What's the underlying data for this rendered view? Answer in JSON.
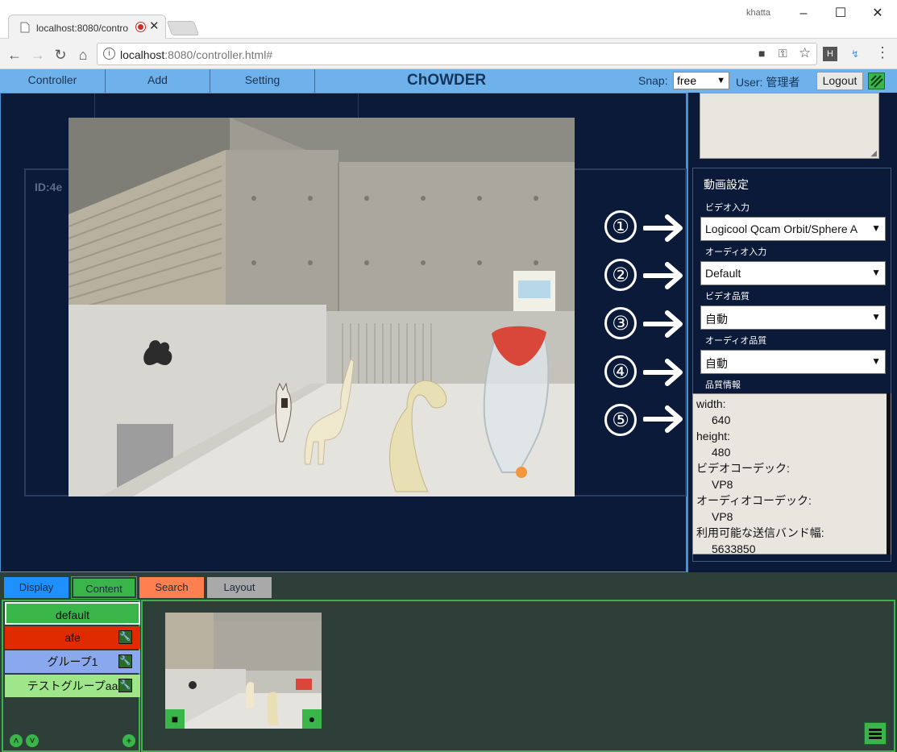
{
  "browser": {
    "tab_title": "localhost:8080/contro",
    "window_user": "khatta",
    "url_host": "localhost",
    "url_rest": ":8080/controller.html#"
  },
  "app": {
    "menu": [
      "Controller",
      "Add",
      "Setting"
    ],
    "brand": "ChOWDER",
    "snap_label": "Snap:",
    "snap_value": "free",
    "user_label": "User: 管理者",
    "logout_label": "Logout"
  },
  "display": {
    "id_label": "ID:4e"
  },
  "annotations": [
    "①",
    "②",
    "③",
    "④",
    "⑤"
  ],
  "video_settings": {
    "title": "動画設定",
    "video_input_label": "ビデオ入力",
    "video_input_value": "Logicool Qcam Orbit/Sphere A",
    "audio_input_label": "オーディオ入力",
    "audio_input_value": "Default",
    "video_quality_label": "ビデオ品質",
    "video_quality_value": "自動",
    "audio_quality_label": "オーディオ品質",
    "audio_quality_value": "自動",
    "quality_info_label": "品質情報",
    "quality_info": [
      {
        "key": "width:",
        "value": "640"
      },
      {
        "key": "height:",
        "value": "480"
      },
      {
        "key": "ビデオコーデック:",
        "value": "VP8"
      },
      {
        "key": "オーディオコーデック:",
        "value": "VP8"
      },
      {
        "key": "利用可能な送信バンド幅:",
        "value": "5633850"
      }
    ]
  },
  "bottom_tabs": [
    {
      "label": "Display",
      "color": "#1e90ff"
    },
    {
      "label": "Content",
      "color": "#39b54a"
    },
    {
      "label": "Search",
      "color": "#ff7f50"
    },
    {
      "label": "Layout",
      "color": "#a9a9a9"
    }
  ],
  "groups": [
    {
      "label": "default",
      "color": "#39b54a"
    },
    {
      "label": "afe",
      "color": "#e02a00"
    },
    {
      "label": "グループ1",
      "color": "#89a8ee"
    },
    {
      "label": "テストグループaa",
      "color": "#9fe58a"
    }
  ],
  "icons": {
    "wrench": "wrench-icon",
    "camera": "video-camera-icon",
    "mic": "microphone-icon",
    "up": "chevron-up-icon",
    "down": "chevron-down-icon",
    "add": "plus-icon",
    "menu": "hamburger-menu-icon"
  }
}
